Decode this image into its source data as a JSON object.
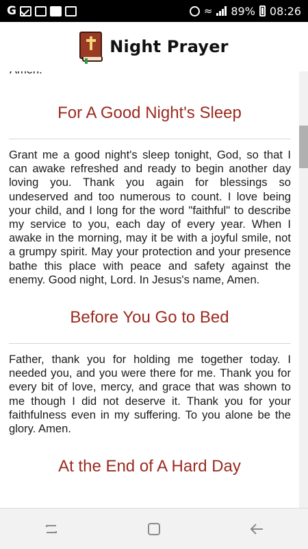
{
  "status_bar": {
    "left_icons": [
      "google-g-icon",
      "mail-icon",
      "notification-icon",
      "badge-icon",
      "image-icon"
    ],
    "g_label": "G",
    "battery_percent": "89%",
    "time": "08:26"
  },
  "header": {
    "title": "Night Prayer"
  },
  "content": {
    "prev_tail": "Amen.",
    "sections": [
      {
        "title": "For A Good Night's Sleep",
        "text": "Grant me a good night's sleep tonight, God, so that I can awake refreshed and ready to begin another day loving you. Thank you again for blessings so undeserved and too numerous to count. I love being your child, and I long for the word \"faithful\" to describe my service to you, each day of every year. When I awake in the morning, may it be with a joyful smile, not a grumpy spirit. May your protection and your presence bathe this place with peace and safety against the enemy. Good night, Lord. In Jesus's name, Amen."
      },
      {
        "title": "Before You Go to Bed",
        "text": "Father, thank you for holding me together today. I needed you, and you were there for me. Thank you for every bit of love, mercy, and grace that was shown to me though I did not deserve it. Thank you for your faithfulness even in my suffering. To you alone be the glory. Amen."
      },
      {
        "title": "At the End of A Hard Day",
        "text": ""
      }
    ]
  },
  "nav_bar": {
    "icons": [
      "recents-icon",
      "home-icon",
      "back-icon"
    ]
  },
  "colors": {
    "section_title": "#9a2a1f",
    "status_bar_bg": "#000000",
    "nav_bar_bg": "#f2f2f2"
  }
}
